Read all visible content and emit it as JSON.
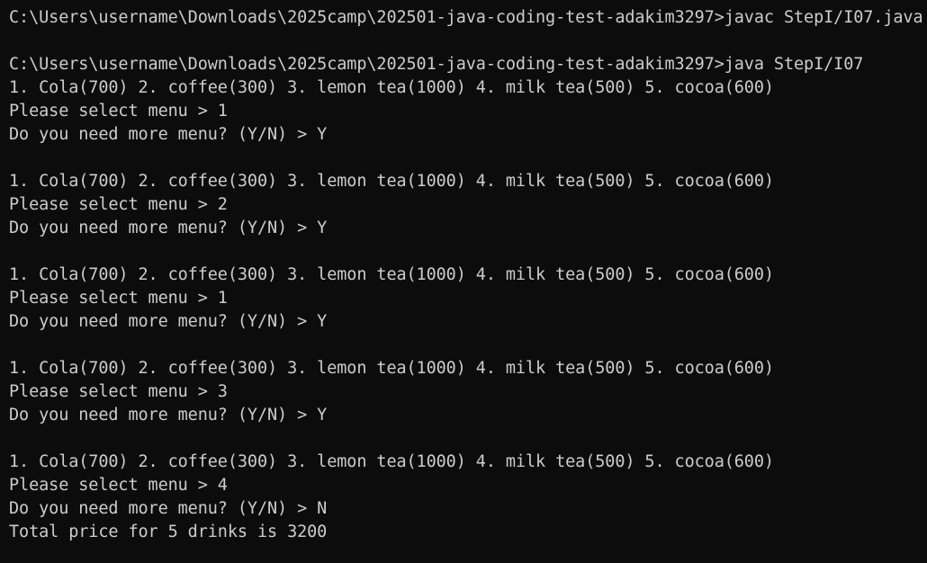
{
  "terminal": {
    "background_color": "#0c0c0c",
    "text_color": "#cccccc",
    "lines": [
      "C:\\Users\\username\\Downloads\\2025camp\\202501-java-coding-test-adakim3297>javac StepI/I07.java",
      "",
      "C:\\Users\\username\\Downloads\\2025camp\\202501-java-coding-test-adakim3297>java StepI/I07",
      "1. Cola(700) 2. coffee(300) 3. lemon tea(1000) 4. milk tea(500) 5. cocoa(600)",
      "Please select menu > 1",
      "Do you need more menu? (Y/N) > Y",
      "",
      "1. Cola(700) 2. coffee(300) 3. lemon tea(1000) 4. milk tea(500) 5. cocoa(600)",
      "Please select menu > 2",
      "Do you need more menu? (Y/N) > Y",
      "",
      "1. Cola(700) 2. coffee(300) 3. lemon tea(1000) 4. milk tea(500) 5. cocoa(600)",
      "Please select menu > 1",
      "Do you need more menu? (Y/N) > Y",
      "",
      "1. Cola(700) 2. coffee(300) 3. lemon tea(1000) 4. milk tea(500) 5. cocoa(600)",
      "Please select menu > 3",
      "Do you need more menu? (Y/N) > Y",
      "",
      "1. Cola(700) 2. coffee(300) 3. lemon tea(1000) 4. milk tea(500) 5. cocoa(600)",
      "Please select menu > 4",
      "Do you need more menu? (Y/N) > N",
      "Total price for 5 drinks is 3200"
    ]
  }
}
